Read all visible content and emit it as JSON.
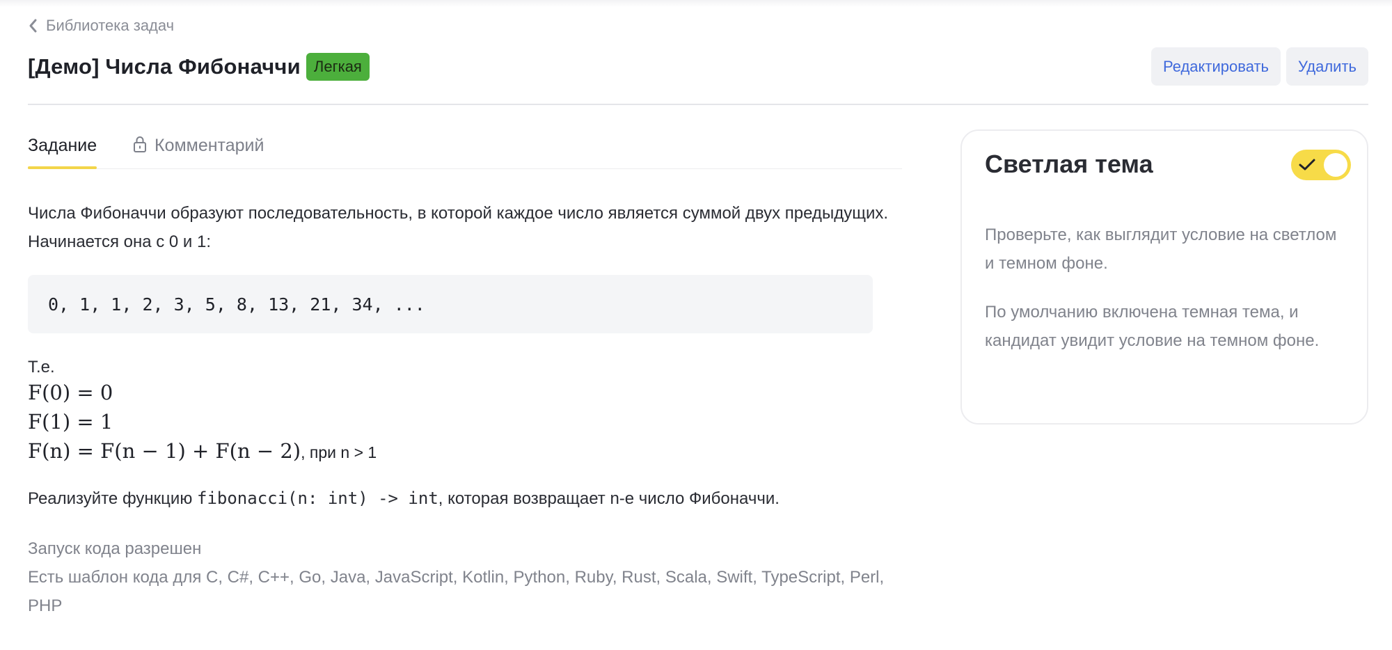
{
  "breadcrumb": {
    "label": "Библиотека задач"
  },
  "header": {
    "title": "[Демо] Числа Фибоначчи",
    "difficulty": "Легкая",
    "edit_label": "Редактировать",
    "delete_label": "Удалить"
  },
  "tabs": [
    {
      "label": "Задание",
      "active": true
    },
    {
      "label": "Комментарий",
      "active": false,
      "icon": "lock-icon"
    }
  ],
  "task": {
    "intro": "Числа Фибоначчи образуют последовательность, в которой каждое число является суммой двух предыдущих. Начинается она с 0 и 1:",
    "sequence": "0, 1, 1, 2, 3, 5, 8, 13, 21, 34, ...",
    "te": "Т.е.",
    "formulas": {
      "f0": "F(0) = 0",
      "f1": "F(1) = 1",
      "fn": "F(n) = F(n − 1) + F(n − 2)",
      "fn_note": ", при n > 1"
    },
    "implement_prefix": "Реализуйте функцию ",
    "implement_code": "fibonacci(n: int) -> int",
    "implement_suffix": ", которая возвращает n-е число Фибоначчи.",
    "run_allowed": "Запуск кода разрешен",
    "templates": "Есть шаблон кода для C, C#, C++, Go, Java, JavaScript, Kotlin, Python, Ruby, Rust, Scala, Swift, TypeScript, Perl, PHP"
  },
  "theme_card": {
    "title": "Светлая тема",
    "toggle_on": true,
    "text1": "Проверьте, как выглядит условие на светлом и темном фоне.",
    "text2": "По умолчанию включена темная тема, и кандидат увидит условие на темном фоне."
  },
  "colors": {
    "accent_yellow": "#f7db48",
    "badge_green": "#4caf3c",
    "link_blue": "#3f69dc"
  }
}
